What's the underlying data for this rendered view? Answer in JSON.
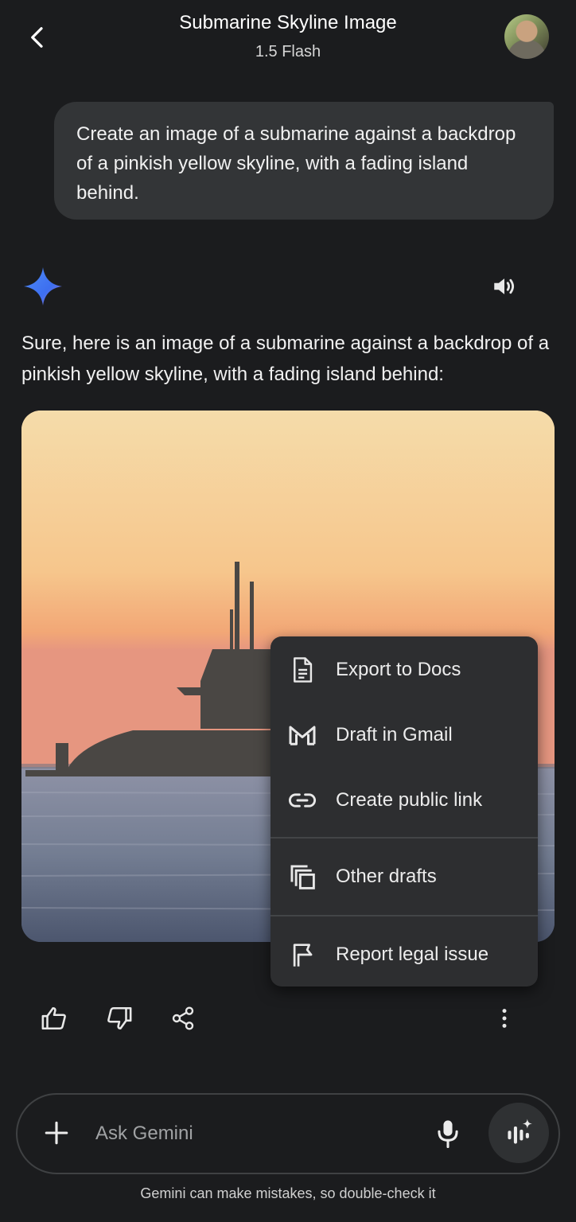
{
  "header": {
    "title": "Submarine Skyline Image",
    "model": "1.5 Flash"
  },
  "conversation": {
    "user_message": "Create an image of a submarine against a backdrop of a pinkish yellow skyline, with a fading island behind.",
    "response_text": "Sure, here is an image of a submarine against a backdrop of a pinkish yellow skyline, with a fading island behind:"
  },
  "menu": {
    "items": [
      {
        "label": "Export to Docs",
        "icon": "docs-icon"
      },
      {
        "label": "Draft in Gmail",
        "icon": "gmail-icon"
      },
      {
        "label": "Create public link",
        "icon": "link-icon"
      },
      {
        "label": "Other drafts",
        "icon": "drafts-icon"
      },
      {
        "label": "Report legal issue",
        "icon": "flag-icon"
      }
    ]
  },
  "input": {
    "placeholder": "Ask Gemini"
  },
  "footer": {
    "disclaimer": "Gemini can make mistakes, so double-check it"
  },
  "colors": {
    "background": "#1b1c1e",
    "bubble": "#333537",
    "menu": "#2d2e30"
  }
}
